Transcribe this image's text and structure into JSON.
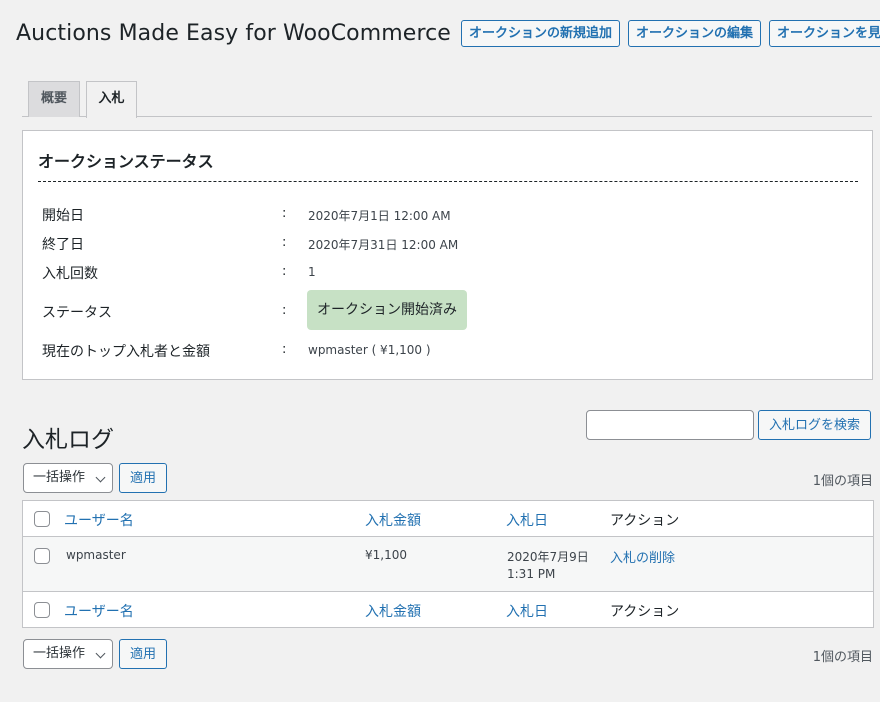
{
  "header": {
    "title": "Auctions Made Easy for WooCommerce",
    "buttons": [
      "オークションの新規追加",
      "オークションの編集",
      "オークションを見る"
    ]
  },
  "tabs": [
    {
      "label": "概要",
      "active": false
    },
    {
      "label": "入札",
      "active": true
    }
  ],
  "status_panel": {
    "heading": "オークションステータス",
    "colon": ":",
    "rows": [
      {
        "label": "開始日",
        "value": "2020年7月1日 12:00 AM"
      },
      {
        "label": "終了日",
        "value": "2020年7月31日 12:00 AM"
      },
      {
        "label": "入札回数",
        "value": "1"
      },
      {
        "label": "ステータス",
        "value": "オークション開始済み"
      },
      {
        "label": "現在のトップ入札者と金額",
        "value": "wpmaster ( ¥1,100 )"
      }
    ],
    "status_color": "#c7e1c5"
  },
  "bid_log": {
    "title": "入札ログ",
    "search_value": "",
    "search_button": "入札ログを検索",
    "bulk_action_label": "一括操作",
    "apply_label": "適用",
    "items_count": "1個の項目",
    "columns": [
      "ユーザー名",
      "入札金額",
      "入札日",
      "アクション"
    ],
    "rows": [
      {
        "user": "wpmaster",
        "amount": "¥1,100",
        "date_line1": "2020年7月9日",
        "date_line2": "1:31 PM",
        "action": "入札の削除"
      }
    ]
  },
  "colors": {
    "accent": "#2271b1",
    "background": "#f1f1f1"
  }
}
